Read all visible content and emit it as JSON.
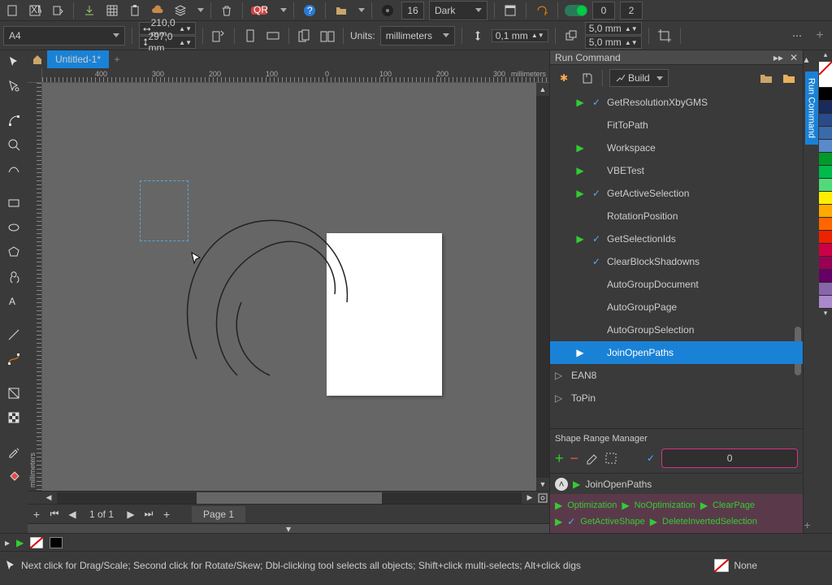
{
  "toolbar1": {
    "theme_label": "Dark",
    "num1": "16",
    "counter_a": "0",
    "counter_b": "2"
  },
  "toolbar2": {
    "page_preset": "A4",
    "width": "210,0 mm",
    "height": "297,0 mm",
    "units_label": "Units:",
    "units_value": "millimeters",
    "nudge": "0,1 mm",
    "dup_x": "5,0 mm",
    "dup_y": "5,0 mm"
  },
  "tabs": {
    "doc_title": "Untitled-1*"
  },
  "ruler": {
    "labels": [
      "400",
      "300",
      "200",
      "100",
      "0",
      "100",
      "200",
      "300"
    ],
    "unit_label": "millimeters",
    "v_unit_label": "millimeters"
  },
  "pager": {
    "page_text": "1  of  1",
    "page_tab": "Page 1"
  },
  "panel": {
    "title": "Run Command",
    "build_label": "Build",
    "commands": [
      {
        "play": true,
        "check": true,
        "label": "GetResolutionXbyGMS"
      },
      {
        "play": false,
        "check": false,
        "label": "FitToPath"
      },
      {
        "play": true,
        "check": false,
        "label": "Workspace"
      },
      {
        "play": true,
        "check": false,
        "label": "VBETest"
      },
      {
        "play": true,
        "check": true,
        "label": "GetActiveSelection"
      },
      {
        "play": false,
        "check": false,
        "label": "RotationPosition"
      },
      {
        "play": true,
        "check": true,
        "label": "GetSelectionIds"
      },
      {
        "play": false,
        "check": true,
        "label": "ClearBlockShadowns"
      },
      {
        "play": false,
        "check": false,
        "label": "AutoGroupDocument"
      },
      {
        "play": false,
        "check": false,
        "label": "AutoGroupPage"
      },
      {
        "play": false,
        "check": false,
        "label": "AutoGroupSelection"
      },
      {
        "play": true,
        "check": false,
        "label": "JoinOpenPaths",
        "selected": true
      },
      {
        "play": false,
        "check": false,
        "label": "EAN8",
        "outdent": true,
        "tree": true
      },
      {
        "play": false,
        "check": false,
        "label": "ToPin",
        "outdent": true,
        "tree": true
      }
    ],
    "shape_range_title": "Shape Range Manager",
    "shape_range_value": "0",
    "quick_current": "JoinOpenPaths",
    "quick_row1": [
      "Optimization",
      "NoOptimization",
      "ClearPage"
    ],
    "quick_row2_labels": [
      "GetActiveShape",
      "DeleteInvertedSelection"
    ]
  },
  "status": {
    "hint": "Next click for Drag/Scale; Second click for Rotate/Skew; Dbl-clicking tool selects all objects; Shift+click multi-selects; Alt+click digs",
    "fill": "None"
  },
  "swatches": [
    "none",
    "#ffffff",
    "#000000",
    "#1a2a5a",
    "#2a4a8a",
    "#3a6aaa",
    "#5a8aca",
    "#009a2a",
    "#00ba4a",
    "#50da7a",
    "#ffee00",
    "#ffaa00",
    "#ff6600",
    "#ee2200",
    "#cc0044",
    "#990055",
    "#660066",
    "#8866aa",
    "#aa88cc"
  ],
  "chart_data": null
}
